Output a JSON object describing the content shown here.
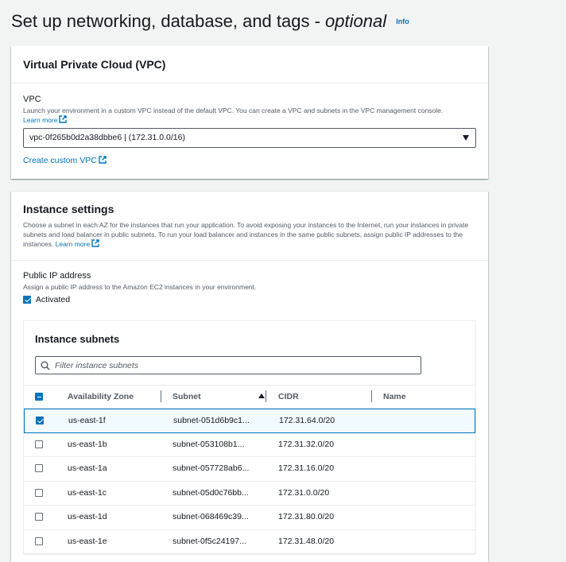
{
  "page": {
    "title": "Set up networking, database, and tags - ",
    "title_optional": "optional",
    "info": "Info"
  },
  "vpc_section": {
    "title": "Virtual Private Cloud (VPC)",
    "label": "VPC",
    "description": "Launch your environment in a custom VPC instead of the default VPC. You can create a VPC and subnets in the VPC management console.",
    "learn_more": "Learn more",
    "selected_vpc": "vpc-0f265b0d2a38dbbe6 | (172.31.0.0/16)",
    "create_custom": "Create custom VPC"
  },
  "instance_settings": {
    "title": "Instance settings",
    "description": "Choose a subnet in each AZ for the instances that run your application. To avoid exposing your instances to the Internet, run your instances in private subnets and load balancer in public subnets. To run your load balancer and instances in the same public subnets, assign public IP addresses to the instances.",
    "learn_more": "Learn more",
    "public_ip_label": "Public IP address",
    "public_ip_desc": "Assign a public IP address to the Amazon EC2 instances in your environment.",
    "activated_label": "Activated",
    "activated": true
  },
  "instance_subnets": {
    "title": "Instance subnets",
    "filter_placeholder": "Filter instance subnets",
    "columns": [
      "Availability Zone",
      "Subnet",
      "CIDR",
      "Name"
    ],
    "sorted_column": "Subnet",
    "rows": [
      {
        "az": "us-east-1f",
        "subnet": "subnet-051d6b9c1...",
        "cidr": "172.31.64.0/20",
        "name": "",
        "selected": true
      },
      {
        "az": "us-east-1b",
        "subnet": "subnet-053108b1...",
        "cidr": "172.31.32.0/20",
        "name": "",
        "selected": false
      },
      {
        "az": "us-east-1a",
        "subnet": "subnet-057728ab6...",
        "cidr": "172.31.16.0/20",
        "name": "",
        "selected": false
      },
      {
        "az": "us-east-1c",
        "subnet": "subnet-05d0c76bb...",
        "cidr": "172.31.0.0/20",
        "name": "",
        "selected": false
      },
      {
        "az": "us-east-1d",
        "subnet": "subnet-068469c39...",
        "cidr": "172.31.80.0/20",
        "name": "",
        "selected": false
      },
      {
        "az": "us-east-1e",
        "subnet": "subnet-0f5c24197...",
        "cidr": "172.31.48.0/20",
        "name": "",
        "selected": false
      }
    ]
  },
  "colors": {
    "accent": "#0073bb",
    "background": "#f2f3f3",
    "text": "#16191f",
    "muted": "#545b64"
  }
}
